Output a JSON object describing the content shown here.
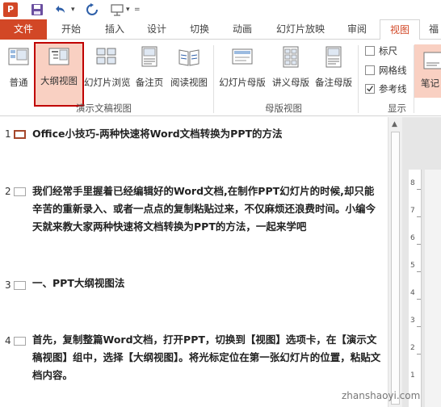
{
  "qat": {
    "app_icon_letter": "P",
    "icons": [
      "powerpoint-icon",
      "save-icon",
      "undo-icon",
      "redo-icon",
      "present-icon"
    ]
  },
  "tabs": {
    "file": "文件",
    "home": "开始",
    "insert": "插入",
    "design": "设计",
    "transitions": "切换",
    "animations": "动画",
    "slideshow": "幻灯片放映",
    "review": "审阅",
    "view": "视图",
    "partial": "福"
  },
  "ribbon": {
    "presentation_views": {
      "group_label": "演示文稿视图",
      "normal": "普通",
      "outline": "大纲视图",
      "slide_sorter": "幻灯片浏览",
      "notes_page": "备注页",
      "reading": "阅读视图"
    },
    "master_views": {
      "group_label": "母版视图",
      "slide_master": "幻灯片母版",
      "handout_master": "讲义母版",
      "notes_master": "备注母版"
    },
    "show": {
      "group_label": "显示",
      "ruler": "标尺",
      "gridlines": "网格线",
      "guides": "参考线",
      "ruler_checked": false,
      "gridlines_checked": false,
      "guides_checked": true
    },
    "notes_partial": "笔记"
  },
  "outline": [
    {
      "num": "1",
      "text": "Office小技巧-两种快速将Word文档转换为PPT的方法"
    },
    {
      "num": "2",
      "text": "我们经常手里握着已经编辑好的Word文档,在制作PPT幻灯片的时候,却只能辛苦的重新录入、或者一点点的复制粘贴过来，不仅麻烦还浪费时间。小编今天就来教大家两种快速将文档转换为PPT的方法，一起来学吧"
    },
    {
      "num": "3",
      "text": "一、PPT大纲视图法"
    },
    {
      "num": "4",
      "text": "首先，复制整篇Word文档，打开PPT，切换到【视图】选项卡，在【演示文稿视图】组中，选择【大纲视图】。将光标定位在第一张幻灯片的位置，粘贴文档内容。"
    }
  ],
  "ruler": {
    "marks": [
      "8",
      "7",
      "6",
      "5",
      "4",
      "3",
      "2",
      "1"
    ]
  },
  "watermark": "zhanshaoyi.com",
  "colors": {
    "accent": "#d24726",
    "selected": "#f9d0c2",
    "highlight": "#c00000"
  }
}
